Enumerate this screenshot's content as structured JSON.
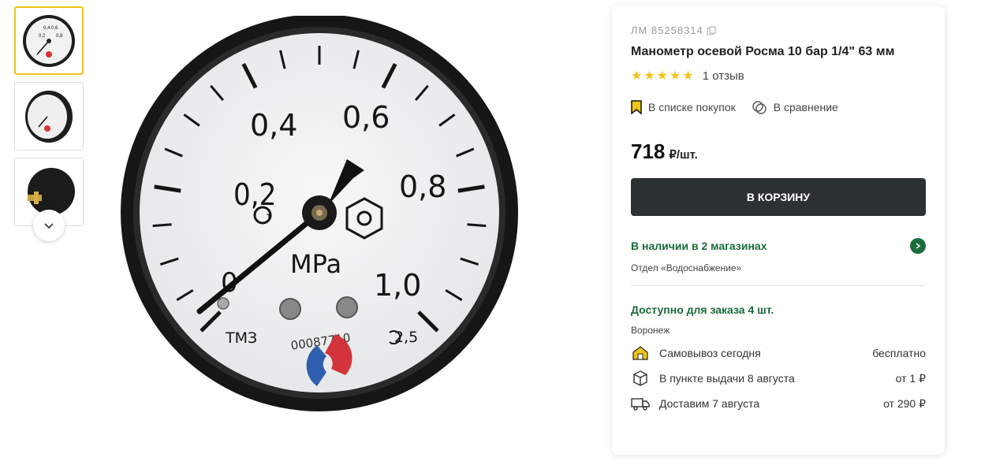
{
  "gallery": {
    "thumbs": [
      "gauge-front",
      "gauge-angle",
      "gauge-back"
    ]
  },
  "product": {
    "sku": "ЛМ 85258314",
    "title": "Манометр осевой Росма 10 бар 1/4\" 63 мм",
    "rating": 5,
    "reviews": "1 отзыв",
    "shopping_list": "В списке покупок",
    "compare": "В сравнение",
    "price": "718",
    "price_unit": "₽/шт.",
    "cart_button": "В КОРЗИНУ"
  },
  "dial": {
    "labels": [
      "0",
      "0,2",
      "0,4",
      "0,6",
      "0,8",
      "1,0"
    ],
    "unit": "MPa",
    "maker": "ТМЗ",
    "serial": "00087710",
    "accuracy": "2,5"
  },
  "availability": {
    "stores": "В наличии в 2 магазинах",
    "department": "Отдел «Водоснабжение»",
    "order": "Доступно для заказа 4 шт.",
    "city": "Воронеж"
  },
  "delivery": [
    {
      "label": "Самовывоз сегодня",
      "price": "бесплатно",
      "icon": "store-icon"
    },
    {
      "label": "В пункте выдачи 8 августа",
      "price": "от 1 ₽",
      "icon": "box-icon"
    },
    {
      "label": "Доставим 7 августа",
      "price": "от 290 ₽",
      "icon": "truck-icon"
    }
  ],
  "colors": {
    "accent": "#f0c419",
    "green": "#1a6d3a",
    "button": "#2c3133"
  }
}
